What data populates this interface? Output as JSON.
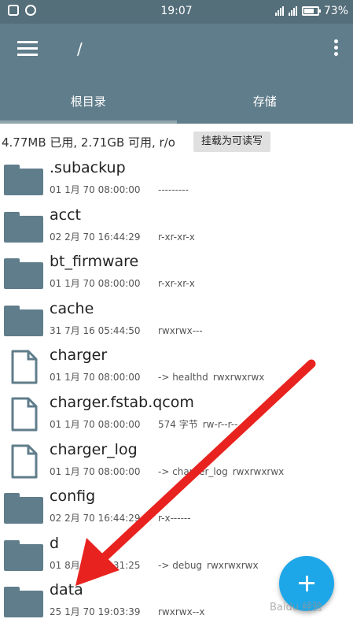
{
  "status_bar": {
    "time": "19:07",
    "battery_text": "73%",
    "battery_level": 0.73
  },
  "app_bar": {
    "path": "/",
    "menu_icon": "hamburger-menu-icon",
    "more_icon": "more-vert-icon"
  },
  "tabs": [
    {
      "label": "根目录",
      "active": true
    },
    {
      "label": "存储",
      "active": false
    }
  ],
  "storage": {
    "info": "4.77MB 已用, 2.71GB 可用, r/o",
    "mount_button": "挂载为可读写"
  },
  "files": [
    {
      "name": ".subackup",
      "type": "folder",
      "date": "01 1月 70 08:00:00",
      "extra": "",
      "perms": "---------"
    },
    {
      "name": "acct",
      "type": "folder",
      "date": "02 2月 70 16:44:29",
      "extra": "",
      "perms": "r-xr-xr-x"
    },
    {
      "name": "bt_firmware",
      "type": "folder",
      "date": "01 1月 70 08:00:00",
      "extra": "",
      "perms": "r-xr-xr-x"
    },
    {
      "name": "cache",
      "type": "folder",
      "date": "31 7月 16 05:44:50",
      "extra": "",
      "perms": "rwxrwx---"
    },
    {
      "name": "charger",
      "type": "file",
      "date": "01 1月 70 08:00:00",
      "extra": "-> healthd",
      "perms": "rwxrwxrwx"
    },
    {
      "name": "charger.fstab.qcom",
      "type": "file",
      "date": "01 1月 70 08:00:00",
      "extra": "574 字节",
      "perms": "rw-r--r--"
    },
    {
      "name": "charger_log",
      "type": "file",
      "date": "01 1月 70 08:00:00",
      "extra": "-> charger_log",
      "perms": "rwxrwxrwx"
    },
    {
      "name": "config",
      "type": "folder",
      "date": "02 2月 70 16:44:29",
      "extra": "",
      "perms": "r-x------"
    },
    {
      "name": "d",
      "type": "folder",
      "date": "01 8月 70 17:31:25",
      "extra": "-> debug",
      "perms": "rwxrwxrwx"
    },
    {
      "name": "data",
      "type": "folder",
      "date": "25 1月 70 19:03:39",
      "extra": "",
      "perms": "rwxrwx--x"
    }
  ],
  "fab": {
    "icon": "add-icon"
  },
  "watermark": "Baidu 经验",
  "colors": {
    "primary": "#607d8b",
    "status_bar": "#546e7a",
    "fab": "#1ea7e8",
    "arrow": "#e8231f"
  }
}
